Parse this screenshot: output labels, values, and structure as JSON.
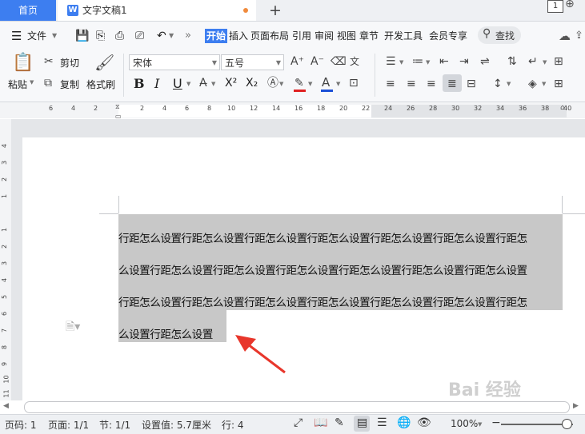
{
  "tabs": {
    "home": "首页",
    "doc_title": "文字文稿1",
    "doc_icon": "W",
    "new_tab": "+"
  },
  "window": {
    "page_count": "1"
  },
  "menu": {
    "file": "文件",
    "items": [
      "开始",
      "插入",
      "页面布局",
      "引用",
      "审阅",
      "视图",
      "章节",
      "开发工具",
      "会员专享"
    ],
    "search": "查找"
  },
  "ribbon": {
    "paste": "粘贴",
    "cut": "剪切",
    "copy": "复制",
    "format_painter": "格式刷",
    "font_name": "宋体",
    "font_size": "五号",
    "bold": "B",
    "italic": "I",
    "underline": "U",
    "superscript": "X²",
    "subscript": "X₂"
  },
  "ruler": {
    "numbers": [
      "6",
      "4",
      "2",
      "2",
      "4",
      "6",
      "8",
      "10",
      "12",
      "14",
      "16",
      "18",
      "20",
      "22",
      "24",
      "26",
      "28",
      "30",
      "32",
      "34",
      "36",
      "38",
      "40"
    ],
    "vertical": [
      "4",
      "3",
      "2",
      "1",
      "1",
      "2",
      "3",
      "4",
      "5",
      "6",
      "7",
      "8",
      "9",
      "10",
      "11"
    ]
  },
  "document": {
    "lines": [
      "行距怎么设置行距怎么设置行距怎么设置行距怎么设置行距怎么设置行距怎么设置行距怎",
      "么设置行距怎么设置行距怎么设置行距怎么设置行距怎么设置行距怎么设置行距怎么设置",
      "行距怎么设置行距怎么设置行距怎么设置行距怎么设置行距怎么设置行距怎么设置行距怎",
      "么设置行距怎么设置"
    ]
  },
  "status": {
    "page_code": "页码: 1",
    "page": "页面: 1/1",
    "section": "节: 1/1",
    "setting": "设置值: 5.7厘米",
    "row": "行: 4",
    "zoom": "100%"
  },
  "colors": {
    "accent": "#3d7ef0",
    "selection": "#c8c8c8",
    "arrow": "#e8362b",
    "font_color_red": "#e02020",
    "font_color_blue": "#1a4fd6"
  },
  "watermark": "Bai 经验"
}
